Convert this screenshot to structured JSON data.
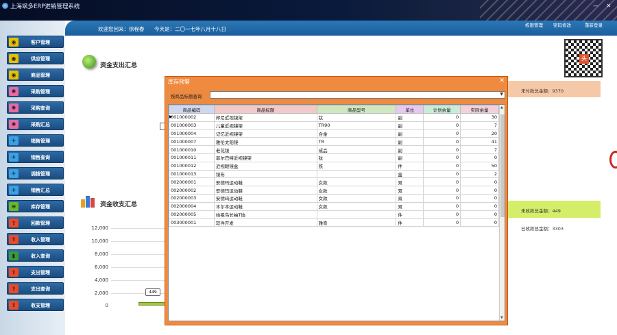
{
  "app": {
    "title": "上海飒多ERP进销管理系统",
    "minimize": "—",
    "close": "✕"
  },
  "subbar": {
    "welcome": "欢迎您回来：徐程春",
    "today": "今天是：二〇一七年八月十八日"
  },
  "toplinks": [
    "权限管理",
    "密码修改",
    "重新登录"
  ],
  "sidebar": {
    "items": [
      {
        "label": "客户管理",
        "icon": "person-icon",
        "color": "#e8c000"
      },
      {
        "label": "供应管理",
        "icon": "truck-icon",
        "color": "#e8c000"
      },
      {
        "label": "商品管理",
        "icon": "box-icon",
        "color": "#e8c000"
      },
      {
        "label": "采购管理",
        "icon": "dribbble-icon",
        "color": "#e86aa0"
      },
      {
        "label": "采购查询",
        "icon": "dribbble-icon",
        "color": "#e86aa0"
      },
      {
        "label": "采购汇总",
        "icon": "dribbble-icon",
        "color": "#e86aa0"
      },
      {
        "label": "销售管理",
        "icon": "bird-icon",
        "color": "#3aa0e8"
      },
      {
        "label": "销售查询",
        "icon": "bird-icon",
        "color": "#3aa0e8"
      },
      {
        "label": "调拨管理",
        "icon": "bird-icon",
        "color": "#3aa0e8"
      },
      {
        "label": "销售汇总",
        "icon": "bird-icon",
        "color": "#3aa0e8"
      },
      {
        "label": "库存管理",
        "icon": "spotify-icon",
        "color": "#6ab82a"
      },
      {
        "label": "回款管理",
        "icon": "upload-icon",
        "color": "#e84a2a"
      },
      {
        "label": "收入管理",
        "icon": "upload-icon",
        "color": "#e84a2a"
      },
      {
        "label": "收入查询",
        "icon": "chart-icon",
        "color": "#3a9a3a"
      },
      {
        "label": "支出管理",
        "icon": "upload-icon",
        "color": "#e84a2a"
      },
      {
        "label": "支出查询",
        "icon": "upload-icon",
        "color": "#e84a2a"
      },
      {
        "label": "收支管理",
        "icon": "upload-icon",
        "color": "#e84a2a"
      }
    ]
  },
  "main": {
    "section1_title": "资金支出汇总",
    "section2_title": "资金收支汇总",
    "unpaid": "未付款总金额：9370",
    "unreceived": "未收款总金额：449",
    "received": "已收款总金额：3303",
    "yaxis": [
      "12,000",
      "10,000",
      "8,000",
      "6,000",
      "4,000",
      "2,000",
      "0"
    ],
    "bar_label": "449",
    "qr_char": "头"
  },
  "dialog": {
    "title": "库存预警",
    "close": "✕",
    "filter_label": "按商品标题查询",
    "filter_value": "",
    "columns": [
      "商品编码",
      "商品标题",
      "商品型号",
      "单位",
      "计划余量",
      "实际余量"
    ],
    "column_colors": [
      "#cfd8f0",
      "#f2c8c8",
      "#cfe8c0",
      "#e6c8f0",
      "#c8ecd8",
      "#f4d0dc"
    ],
    "rows": [
      [
        "001000002",
        "邦尼近视镜架",
        "钛",
        "副",
        "0",
        "30"
      ],
      [
        "001000003",
        "儿童近视镜架",
        "TR90",
        "副",
        "0",
        "7"
      ],
      [
        "001000004",
        "记忆近视镜架",
        "合金",
        "副",
        "0",
        "20"
      ],
      [
        "001000007",
        "雅伦太阳镜",
        "TR",
        "副",
        "0",
        "41"
      ],
      [
        "001000010",
        "老花镜",
        "成品",
        "副",
        "0",
        "7"
      ],
      [
        "001000011",
        "菲尔巴特近视镜架",
        "钛",
        "副",
        "0",
        "0"
      ],
      [
        "001000012",
        "近视眼镜盒",
        "铁",
        "件",
        "0",
        "50"
      ],
      [
        "001000013",
        "镜布",
        "",
        "盒",
        "0",
        "2"
      ],
      [
        "002000001",
        "安德玛运动鞋",
        "女款",
        "双",
        "0",
        "0"
      ],
      [
        "002000002",
        "安德玛运动鞋",
        "女款",
        "双",
        "0",
        "0"
      ],
      [
        "002000003",
        "安德玛运动鞋",
        "女款",
        "双",
        "0",
        "0"
      ],
      [
        "002000004",
        "木尔本运动鞋",
        "女款",
        "双",
        "0",
        "0"
      ],
      [
        "002000005",
        "始祖鸟长袖T恤",
        "",
        "件",
        "0",
        "0"
      ],
      [
        "003000001",
        "软件开发",
        "雅奇",
        "件",
        "0",
        "0"
      ]
    ]
  }
}
